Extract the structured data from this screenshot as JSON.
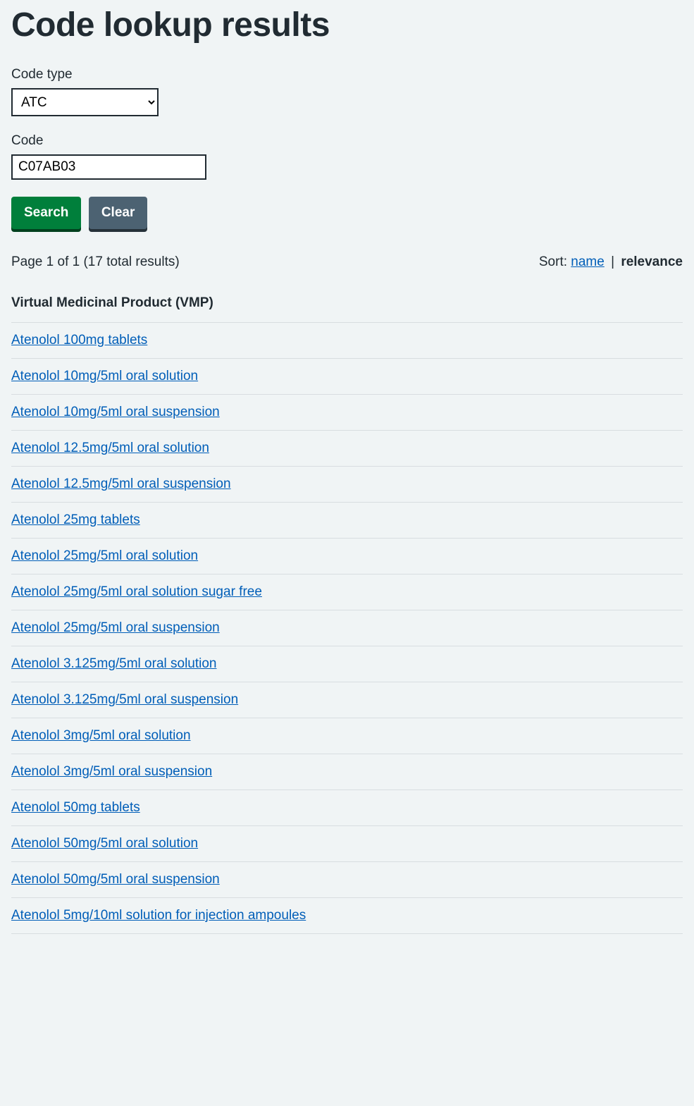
{
  "page": {
    "title": "Code lookup results"
  },
  "form": {
    "code_type_label": "Code type",
    "code_type_value": "ATC",
    "code_label": "Code",
    "code_value": "C07AB03",
    "search_button": "Search",
    "clear_button": "Clear"
  },
  "results_meta": {
    "page_text": "Page 1 of 1 (17 total results)",
    "sort_label": "Sort: ",
    "sort_name": "name",
    "sort_separator": " | ",
    "sort_relevance": "relevance"
  },
  "section_header": "Virtual Medicinal Product (VMP)",
  "results": [
    "Atenolol 100mg tablets",
    "Atenolol 10mg/5ml oral solution",
    "Atenolol 10mg/5ml oral suspension",
    "Atenolol 12.5mg/5ml oral solution",
    "Atenolol 12.5mg/5ml oral suspension",
    "Atenolol 25mg tablets",
    "Atenolol 25mg/5ml oral solution",
    "Atenolol 25mg/5ml oral solution sugar free",
    "Atenolol 25mg/5ml oral suspension",
    "Atenolol 3.125mg/5ml oral solution",
    "Atenolol 3.125mg/5ml oral suspension",
    "Atenolol 3mg/5ml oral solution",
    "Atenolol 3mg/5ml oral suspension",
    "Atenolol 50mg tablets",
    "Atenolol 50mg/5ml oral solution",
    "Atenolol 50mg/5ml oral suspension",
    "Atenolol 5mg/10ml solution for injection ampoules"
  ]
}
